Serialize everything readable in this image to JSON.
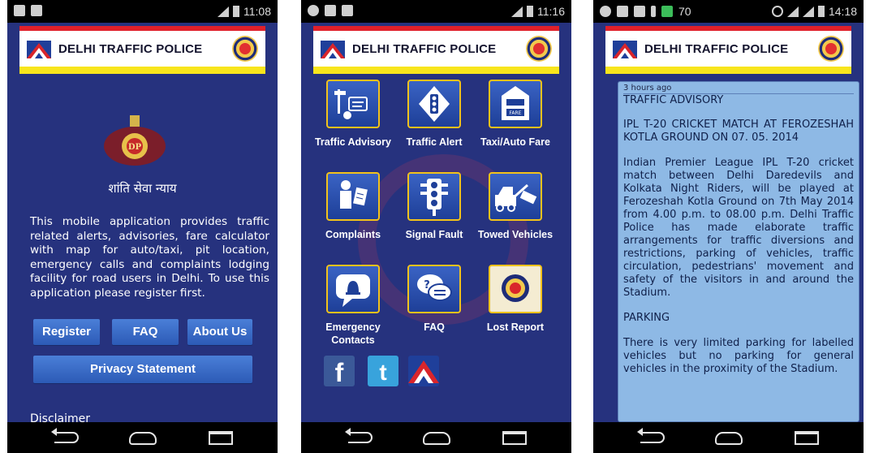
{
  "screens": [
    {
      "status": {
        "time": "11:08"
      },
      "banner": {
        "title": "DELHI TRAFFIC POLICE"
      },
      "motto": "शांति सेवा न्याय",
      "intro": "This mobile application provides traffic related alerts, advisories, fare calculator with map for auto/taxi, pit location, emergency calls and complaints lodging facility for road users in Delhi. To use this application please register first.",
      "buttons": {
        "register": "Register",
        "faq": "FAQ",
        "about": "About Us",
        "privacy": "Privacy Statement"
      },
      "disclaimer": "Disclaimer"
    },
    {
      "status": {
        "time": "11:16"
      },
      "banner": {
        "title": "DELHI TRAFFIC POLICE"
      },
      "tiles": [
        {
          "label": "Traffic Advisory",
          "icon": "signpost-icon"
        },
        {
          "label": "Traffic Alert",
          "icon": "traffic-sign-icon"
        },
        {
          "label": "Taxi/Auto Fare",
          "icon": "fare-meter-icon"
        },
        {
          "label": "Complaints",
          "icon": "complaint-icon"
        },
        {
          "label": "Signal Fault",
          "icon": "traffic-light-icon"
        },
        {
          "label": "Towed Vehicles",
          "icon": "tow-truck-icon"
        },
        {
          "label": "Emergency Contacts",
          "icon": "siren-icon"
        },
        {
          "label": "FAQ",
          "icon": "chat-bubbles-icon"
        },
        {
          "label": "Lost Report",
          "icon": "police-seal-icon"
        }
      ],
      "social": [
        "facebook-icon",
        "twitter-icon",
        "delhi-police-icon"
      ]
    },
    {
      "status": {
        "time": "14:18",
        "notif_count": "70"
      },
      "banner": {
        "title": "DELHI TRAFFIC POLICE"
      },
      "card": {
        "time": "3 hours ago",
        "heading": "TRAFFIC ADVISORY",
        "p1": "IPL T-20 CRICKET MATCH AT FEROZESHAH KOTLA GROUND ON 07. 05. 2014",
        "p2": "Indian Premier League IPL T-20 cricket match between Delhi Daredevils and Kolkata Night Riders, will be played at Ferozeshah Kotla Ground on 7th May 2014 from 4.00 p.m. to 08.00 p.m. Delhi Traffic Police has made elaborate traffic arrangements for traffic diversions and restrictions, parking of vehicles, traffic circulation, pedestrians' movement and safety of the visitors in and around the Stadium.",
        "p3": "PARKING",
        "p4": "There is very limited parking for labelled vehicles but no parking for general vehicles in the proximity of the Stadium."
      }
    }
  ],
  "colors": {
    "background": "#26327e",
    "tile_border": "#f2c21b",
    "button": "#3b6fce",
    "card": "#8eb9e5"
  }
}
